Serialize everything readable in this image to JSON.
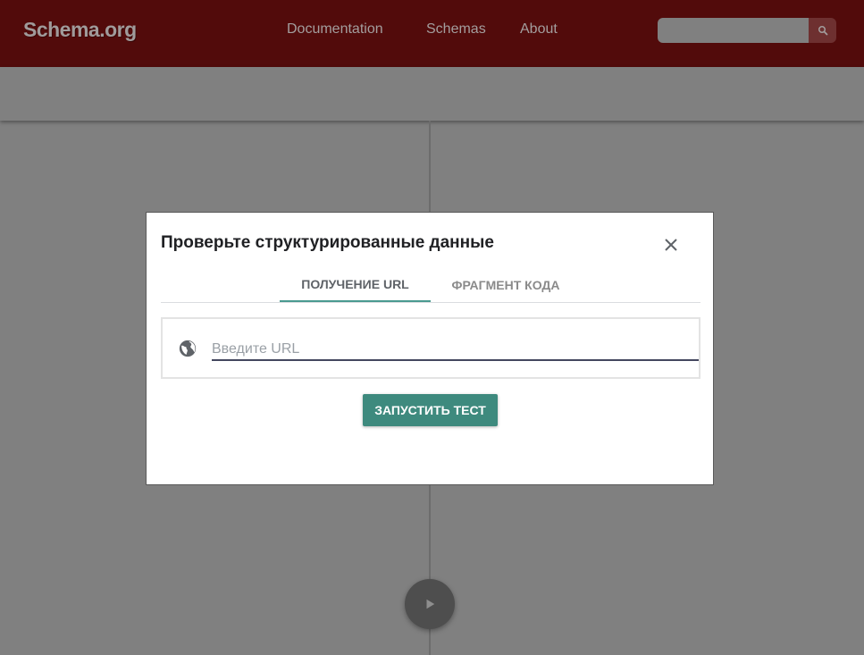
{
  "header": {
    "logo": "Schema.org",
    "nav": [
      "Documentation",
      "Schemas",
      "About"
    ],
    "search_placeholder": "",
    "search_icon": "search-icon"
  },
  "dialog": {
    "title": "Проверьте структурированные данные",
    "close_icon": "close-icon",
    "tabs": [
      {
        "label": "ПОЛУЧЕНИЕ URL",
        "active": true
      },
      {
        "label": "ФРАГМЕНТ КОДА",
        "active": false
      }
    ],
    "url_input_placeholder": "Введите URL",
    "url_input_value": "",
    "globe_icon": "globe-icon",
    "run_button_label": "ЗАПУСТИТЬ ТЕСТ"
  },
  "editor": {
    "run_fab_icon": "play-icon"
  },
  "colors": {
    "header_bg": "#520b0b",
    "accent": "#3e8a7e",
    "overlay": "#808080"
  }
}
